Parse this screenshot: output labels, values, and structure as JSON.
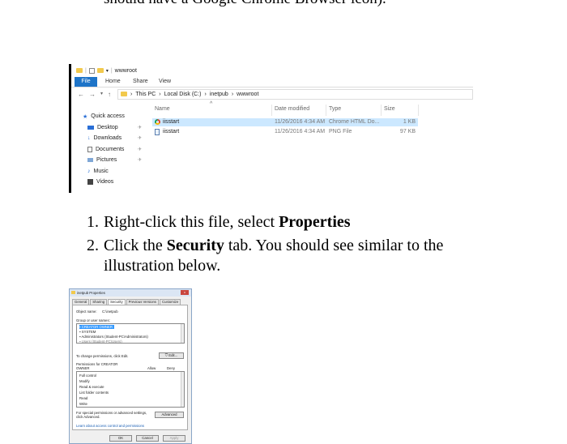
{
  "top_text": "should have a Google Chrome Browser icon).",
  "explorer": {
    "window_title": "wwwroot",
    "ribbon_tabs": [
      "File",
      "Home",
      "Share",
      "View"
    ],
    "breadcrumb": [
      "This PC",
      "Local Disk (C:)",
      "inetpub",
      "wwwroot"
    ],
    "nav_items": [
      {
        "label": "Quick access",
        "icon": "star-icon",
        "pinned": false
      },
      {
        "label": "Desktop",
        "icon": "desktop-icon",
        "pinned": true
      },
      {
        "label": "Downloads",
        "icon": "download-icon",
        "pinned": true
      },
      {
        "label": "Documents",
        "icon": "documents-icon",
        "pinned": true
      },
      {
        "label": "Pictures",
        "icon": "pictures-icon",
        "pinned": true
      },
      {
        "label": "Music",
        "icon": "music-icon",
        "pinned": false
      },
      {
        "label": "Videos",
        "icon": "videos-icon",
        "pinned": false
      }
    ],
    "columns": {
      "name": "Name",
      "date": "Date modified",
      "type": "Type",
      "size": "Size"
    },
    "files": [
      {
        "name": "iisstart",
        "date": "11/26/2016 4:34 AM",
        "type": "Chrome HTML Do...",
        "size": "1 KB",
        "icon": "chrome-icon",
        "selected": true
      },
      {
        "name": "iisstart",
        "date": "11/26/2016 4:34 AM",
        "type": "PNG File",
        "size": "97 KB",
        "icon": "png-file-icon",
        "selected": false
      }
    ]
  },
  "steps": [
    {
      "num": "1.",
      "pre": "Right-click this file, select ",
      "bold": "Properties",
      "post": ""
    },
    {
      "num": "2.",
      "pre": "Click the ",
      "bold": "Security",
      "post": " tab. You should see similar to the illustration below."
    }
  ],
  "dialog": {
    "title": "inetpub Properties",
    "close": "x",
    "tabs": [
      "General",
      "Sharing",
      "Security",
      "Previous Versions",
      "Customize"
    ],
    "object_label": "Object name:",
    "object_value": "C:\\inetpub",
    "group_label": "Group or user names:",
    "groups": [
      "CREATOR OWNER",
      "SYSTEM",
      "Administrators (Student-PC\\Administrators)",
      "Users (Student-PC\\Users)"
    ],
    "change_text": "To change permissions, click Edit.",
    "edit_button": "Edit...",
    "perm_for_line1": "Permissions for CREATOR",
    "perm_for_line2": "OWNER",
    "allow": "Allow",
    "deny": "Deny",
    "permissions": [
      "Full control",
      "Modify",
      "Read & execute",
      "List folder contents",
      "Read",
      "Write"
    ],
    "special_line1": "For special permissions or advanced settings,",
    "special_line2": "click Advanced.",
    "advanced_button": "Advanced",
    "learn_link": "Learn about access control and permissions",
    "ok": "OK",
    "cancel": "Cancel",
    "apply": "Apply"
  }
}
